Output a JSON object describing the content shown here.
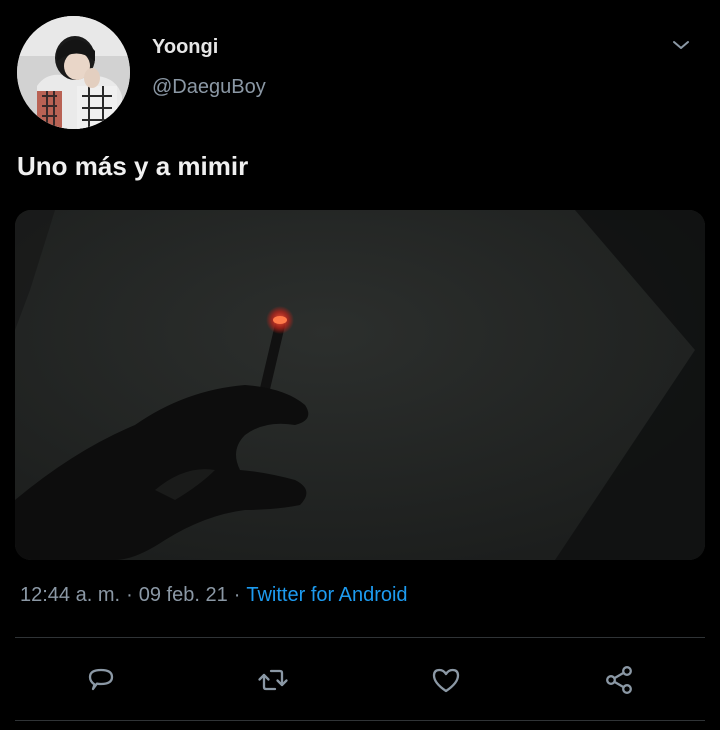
{
  "user": {
    "display_name": "Yoongi",
    "handle": "@DaeguBoy"
  },
  "tweet": {
    "text": "Uno más y a mimir",
    "time": "12:44 a. m.",
    "date": "09 feb. 21",
    "separator": "·",
    "source": "Twitter for Android"
  },
  "icons": {
    "more": "chevron-down-icon",
    "reply": "comment-icon",
    "retweet": "retweet-icon",
    "like": "heart-icon",
    "share": "share-icon"
  },
  "colors": {
    "background": "#000000",
    "text_primary": "#e6e6e6",
    "text_secondary": "#8b98a5",
    "link": "#1d9bf0",
    "divider": "#2f3336",
    "icon": "#8b98a5"
  }
}
